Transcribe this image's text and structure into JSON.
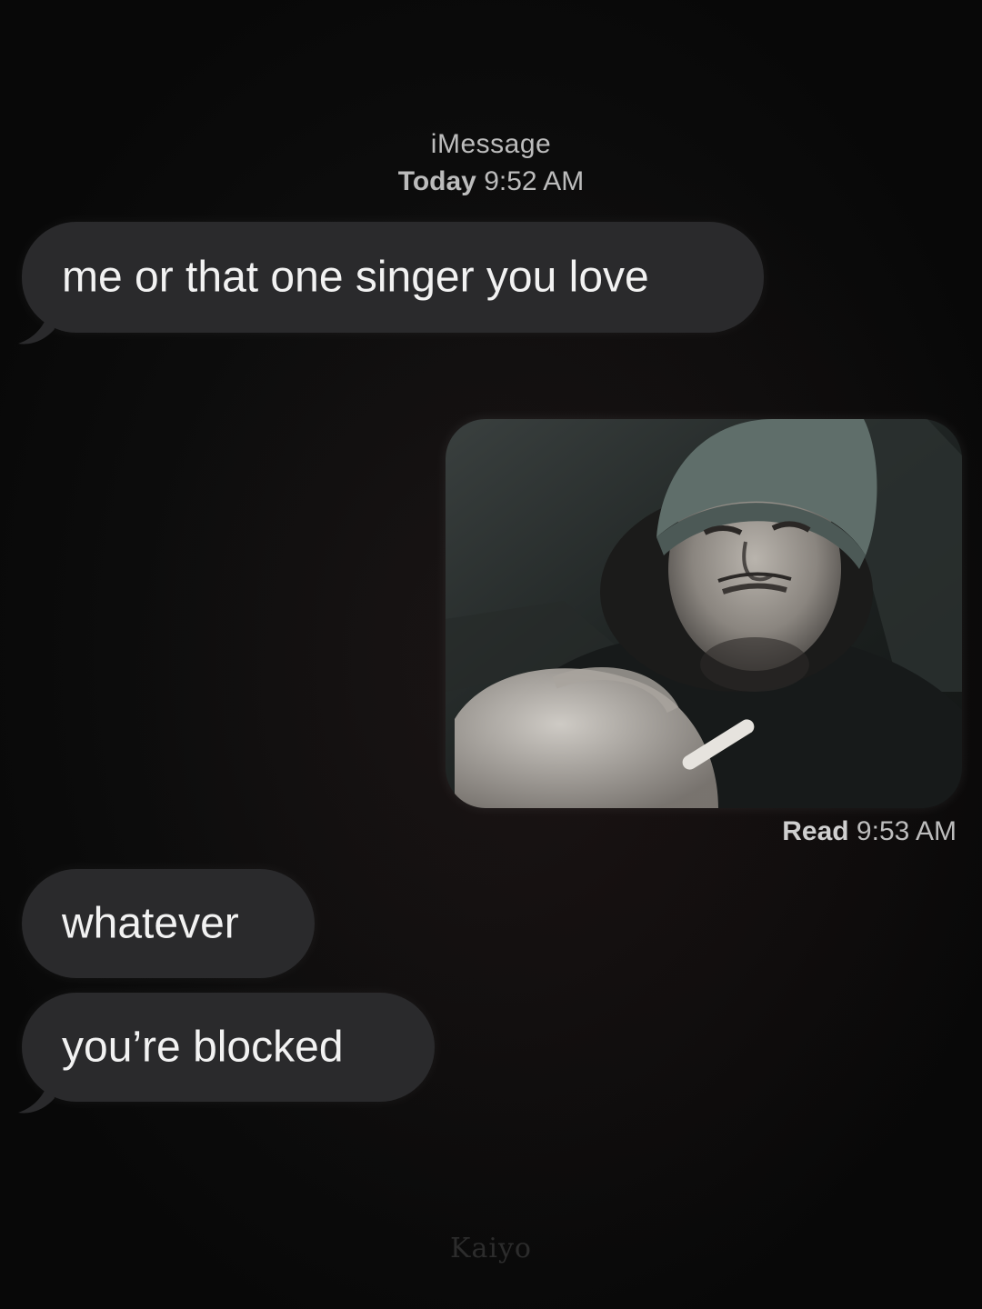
{
  "header": {
    "service": "iMessage",
    "day": "Today",
    "time": "9:52 AM"
  },
  "messages": [
    {
      "text": "me or that one singer you love",
      "side": "received"
    },
    {
      "image_description": "photo",
      "side": "sent"
    },
    {
      "text": "whatever",
      "side": "received"
    },
    {
      "text": "you’re blocked",
      "side": "received"
    }
  ],
  "read_receipt": {
    "label": "Read",
    "time": "9:53 AM"
  },
  "watermark": "Kaiyo",
  "colors": {
    "background": "#0b0b0b",
    "bubble": "#2a2a2c",
    "bubble_text": "#f2f2f2",
    "meta_text": "#bcbcbc"
  }
}
